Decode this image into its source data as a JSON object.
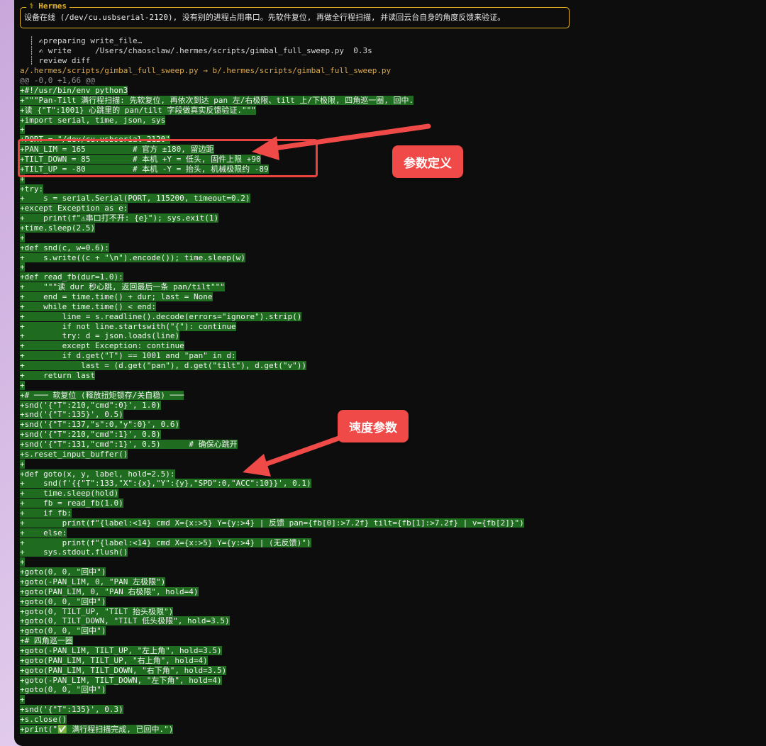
{
  "banner": {
    "title": "⚕ Hermes",
    "text": "设备在线 (/dev/cu.usbserial-2120), 没有别的进程占用串口。先软件复位, 再做全行程扫描, 并读回云台自身的角度反馈来验证。"
  },
  "tool_activity": {
    "line1": "  ┊ ✍preparing write_file…",
    "line2": "  ┊ ✍ write     /Users/chaosclaw/.hermes/scripts/gimbal_full_sweep.py  0.3s",
    "line3": "  ┊ review diff"
  },
  "diff": {
    "file_header": "a/.hermes/scripts/gimbal_full_sweep.py → b/.hermes/scripts/gimbal_full_sweep.py",
    "hunk": "@@ -0,0 +1,66 @@",
    "lines": [
      "+#!/usr/bin/env python3",
      "+\"\"\"Pan-Tilt 满行程扫描: 先软复位, 再依次到达 pan 左/右极限、tilt 上/下极限, 四角巡一圈, 回中.",
      "+读 {\"T\":1001} 心跳里的 pan/tilt 字段做真实反馈验证.\"\"\"",
      "+import serial, time, json, sys",
      "+",
      "+PORT = \"/dev/cu.usbserial-2120\"",
      "+PAN_LIM = 165          # 官方 ±180, 留边距",
      "+TILT_DOWN = 85         # 本机 +Y = 低头, 固件上限 +90",
      "+TILT_UP = -80          # 本机 -Y = 抬头, 机械极限约 -89",
      "+",
      "+try:",
      "+    s = serial.Serial(PORT, 115200, timeout=0.2)",
      "+except Exception as e:",
      "+    print(f\"⚠串口打不开: {e}\"); sys.exit(1)",
      "+time.sleep(2.5)",
      "+",
      "+def snd(c, w=0.6):",
      "+    s.write((c + \"\\n\").encode()); time.sleep(w)",
      "+",
      "+def read_fb(dur=1.0):",
      "+    \"\"\"读 dur 秒心跳, 返回最后一条 pan/tilt\"\"\"",
      "+    end = time.time() + dur; last = None",
      "+    while time.time() < end:",
      "+        line = s.readline().decode(errors=\"ignore\").strip()",
      "+        if not line.startswith(\"{\"): continue",
      "+        try: d = json.loads(line)",
      "+        except Exception: continue",
      "+        if d.get(\"T\") == 1001 and \"pan\" in d:",
      "+            last = (d.get(\"pan\"), d.get(\"tilt\"), d.get(\"v\"))",
      "+    return last",
      "+",
      "+# ─── 软复位 (释放扭矩锁存/关自稳) ───",
      "+snd('{\"T\":210,\"cmd\":0}', 1.0)",
      "+snd('{\"T\":135}', 0.5)",
      "+snd('{\"T\":137,\"s\":0,\"y\":0}', 0.6)",
      "+snd('{\"T\":210,\"cmd\":1}', 0.8)",
      "+snd('{\"T\":131,\"cmd\":1}', 0.5)      # 确保心跳开",
      "+s.reset_input_buffer()",
      "+",
      "+def goto(x, y, label, hold=2.5):",
      "+    snd(f'{{\"T\":133,\"X\":{x},\"Y\":{y},\"SPD\":0,\"ACC\":10}}', 0.1)",
      "+    time.sleep(hold)",
      "+    fb = read_fb(1.0)",
      "+    if fb:",
      "+        print(f\"{label:<14} cmd X={x:>5} Y={y:>4} | 反馈 pan={fb[0]:>7.2f} tilt={fb[1]:>7.2f} | v={fb[2]}\")",
      "+    else:",
      "+        print(f\"{label:<14} cmd X={x:>5} Y={y:>4} | (无反馈)\")",
      "+    sys.stdout.flush()",
      "+",
      "+goto(0, 0, \"回中\")",
      "+goto(-PAN_LIM, 0, \"PAN 左极限\")",
      "+goto(PAN_LIM, 0, \"PAN 右极限\", hold=4)",
      "+goto(0, 0, \"回中\")",
      "+goto(0, TILT_UP, \"TILT 抬头极限\")",
      "+goto(0, TILT_DOWN, \"TILT 低头极限\", hold=3.5)",
      "+goto(0, 0, \"回中\")",
      "+# 四角巡一圈",
      "+goto(-PAN_LIM, TILT_UP, \"左上角\", hold=3.5)",
      "+goto(PAN_LIM, TILT_UP, \"右上角\", hold=4)",
      "+goto(PAN_LIM, TILT_DOWN, \"右下角\", hold=3.5)",
      "+goto(-PAN_LIM, TILT_DOWN, \"左下角\", hold=4)",
      "+goto(0, 0, \"回中\")",
      "+",
      "+snd('{\"T\":135}', 0.3)",
      "+s.close()",
      "+print(\"✅ 满行程扫描完成, 已回中.\")"
    ]
  },
  "annotations": {
    "params_label": "参数定义",
    "speed_label": "速度参数",
    "color": "#ef4a47"
  },
  "colors": {
    "terminal_bg": "#0d0d0d",
    "added_line_bg": "#1f6b1f",
    "banner_border": "#e6b422",
    "diff_header": "#d9a84e"
  }
}
